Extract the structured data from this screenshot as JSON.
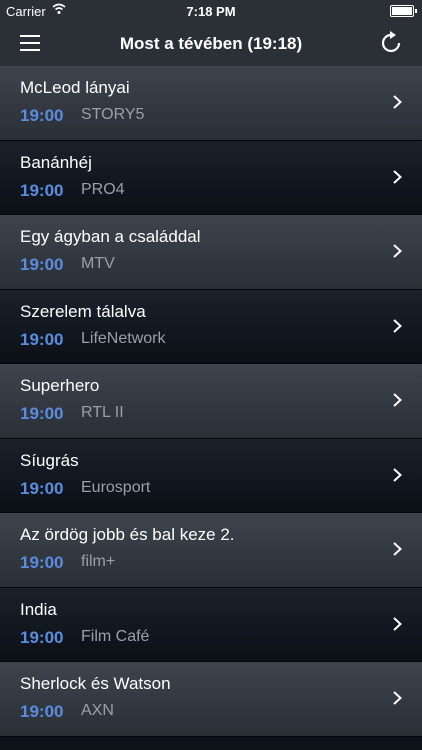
{
  "status": {
    "carrier": "Carrier",
    "time": "7:18 PM"
  },
  "nav": {
    "title": "Most a tévében (19:18)"
  },
  "rows": [
    {
      "title": "McLeod lányai",
      "time": "19:00",
      "channel": "STORY5"
    },
    {
      "title": "Banánhéj",
      "time": "19:00",
      "channel": "PRO4"
    },
    {
      "title": "Egy ágyban a családdal",
      "time": "19:00",
      "channel": "MTV"
    },
    {
      "title": "Szerelem tálalva",
      "time": "19:00",
      "channel": "LifeNetwork"
    },
    {
      "title": "Superhero",
      "time": "19:00",
      "channel": "RTL II"
    },
    {
      "title": "Síugrás",
      "time": "19:00",
      "channel": "Eurosport"
    },
    {
      "title": "Az ördög jobb és bal keze 2.",
      "time": "19:00",
      "channel": "film+"
    },
    {
      "title": "India",
      "time": "19:00",
      "channel": "Film Café"
    },
    {
      "title": "Sherlock és Watson",
      "time": "19:00",
      "channel": "AXN"
    }
  ],
  "colors": {
    "accent_time": "#5a8cdf",
    "channel_text": "#9aa0a8"
  },
  "icons": {
    "menu": "hamburger-icon",
    "refresh": "refresh-icon",
    "row_disclosure": "chevron-right-icon",
    "wifi": "wifi-icon",
    "battery": "battery-icon"
  }
}
